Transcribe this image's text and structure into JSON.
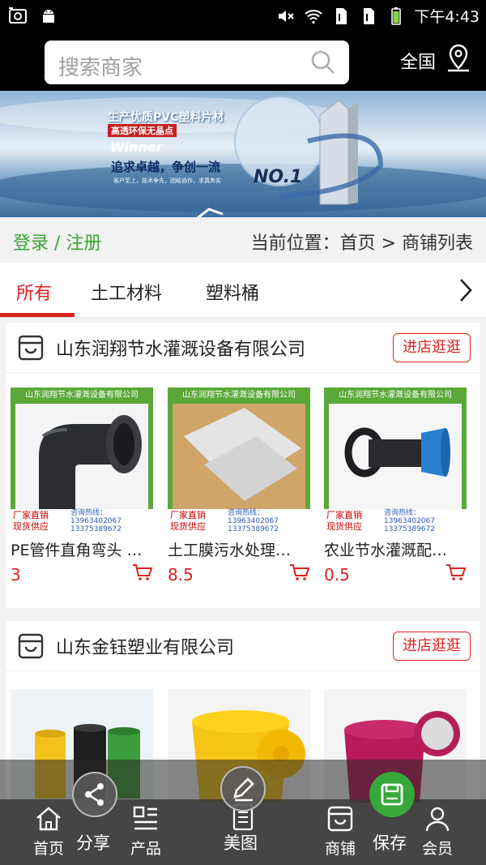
{
  "status_bar": {
    "time": "下午4:43"
  },
  "header": {
    "search_placeholder": "搜索商家",
    "region": "全国"
  },
  "banner": {
    "line1": "生产优质PVC塑料片材",
    "line2": "高透环保无晶点",
    "line3": "Winner",
    "line4": "追求卓越，争创一流",
    "line5": "客户至上，技术争先，团结协作，求真务实",
    "badge": "NO.1"
  },
  "nav": {
    "login": "登录 / 注册",
    "breadcrumb": "当前位置：首页 > 商铺列表"
  },
  "tabs": [
    "所有",
    "土工材料",
    "塑料桶"
  ],
  "shops": [
    {
      "name": "山东润翔节水灌溉设备有限公司",
      "enter_label": "进店逛逛",
      "image_banner": "山东润翔节水灌溉设备有限公司",
      "image_tag1": "厂家直销",
      "image_tag2": "现货供应",
      "image_hotline": "咨询热线：",
      "image_phone1": "13963402067",
      "image_phone2": "13375389672",
      "products": [
        {
          "title": "PE管件直角弯头 …",
          "price": "3"
        },
        {
          "title": "土工膜污水处理…",
          "price": "8.5"
        },
        {
          "title": "农业节水灌溉配…",
          "price": "0.5"
        }
      ]
    },
    {
      "name": "山东金钰塑业有限公司",
      "enter_label": "进店逛逛",
      "products": []
    }
  ],
  "bottom_nav": {
    "home": "首页",
    "share": "分享",
    "products": "产品",
    "gallery": "美图",
    "shops": "商铺",
    "save": "保存",
    "member": "会员"
  },
  "colors": {
    "accent_red": "#e02020",
    "login_green": "#3aa335",
    "save_green": "#36a83a"
  }
}
